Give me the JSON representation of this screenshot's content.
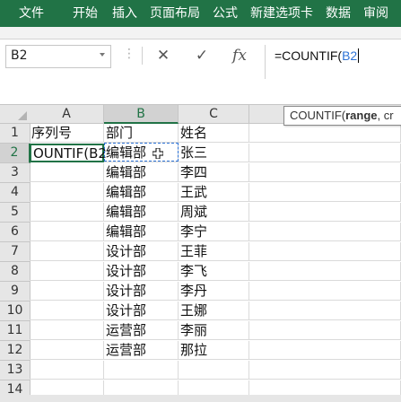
{
  "ribbon": {
    "tabs": [
      "文件",
      "开始",
      "插入",
      "页面布局",
      "公式",
      "新建选项卡",
      "数据",
      "审阅"
    ]
  },
  "formula_bar": {
    "name_box": "B2",
    "cancel_icon": "✕",
    "enter_icon": "✓",
    "fx_label": "fx",
    "formula_prefix": "=COUNTIF(",
    "formula_ref": "B2"
  },
  "tooltip": {
    "func": "COUNTIF(",
    "arg1": "range",
    "rest": ", cr"
  },
  "columns": [
    "A",
    "B",
    "C"
  ],
  "rows": [
    {
      "num": "1",
      "a": "序列号",
      "b": "部门",
      "c": "姓名"
    },
    {
      "num": "2",
      "a": "OUNTIF(B2",
      "b": "编辑部",
      "c": "张三"
    },
    {
      "num": "3",
      "a": "",
      "b": "编辑部",
      "c": "李四"
    },
    {
      "num": "4",
      "a": "",
      "b": "编辑部",
      "c": "王武"
    },
    {
      "num": "5",
      "a": "",
      "b": "编辑部",
      "c": "周斌"
    },
    {
      "num": "6",
      "a": "",
      "b": "编辑部",
      "c": "李宁"
    },
    {
      "num": "7",
      "a": "",
      "b": "设计部",
      "c": "王菲"
    },
    {
      "num": "8",
      "a": "",
      "b": "设计部",
      "c": "李飞"
    },
    {
      "num": "9",
      "a": "",
      "b": "设计部",
      "c": "李丹"
    },
    {
      "num": "10",
      "a": "",
      "b": "设计部",
      "c": "王娜"
    },
    {
      "num": "11",
      "a": "",
      "b": "运营部",
      "c": "李丽"
    },
    {
      "num": "12",
      "a": "",
      "b": "运营部",
      "c": "那拉"
    },
    {
      "num": "13",
      "a": "",
      "b": "",
      "c": ""
    },
    {
      "num": "14",
      "a": "",
      "b": "",
      "c": ""
    }
  ],
  "colors": {
    "accent": "#217346",
    "reference": "#2e73d6"
  }
}
